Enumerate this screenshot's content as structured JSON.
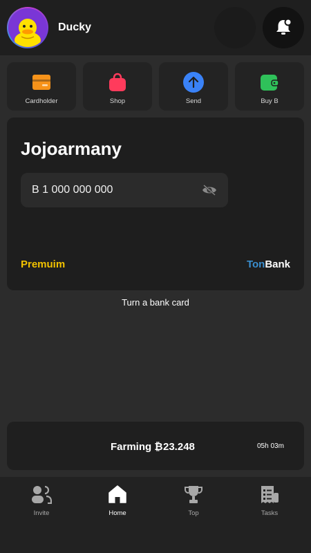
{
  "header": {
    "username": "Ducky",
    "avatar_icon": "duck-avatar-icon",
    "bell_icon": "bell-notification-icon"
  },
  "actions": [
    {
      "label": "Cardholder",
      "icon": "cardholder-icon",
      "color": "#f7931a"
    },
    {
      "label": "Shop",
      "icon": "shop-bag-icon",
      "color": "#ff3b5c"
    },
    {
      "label": "Send",
      "icon": "send-arrow-up-icon",
      "color": "#3a82f7"
    },
    {
      "label": "Buy B",
      "icon": "wallet-icon",
      "color": "#2fc15a"
    }
  ],
  "card": {
    "title": "Jojoarmany",
    "balance": "B 1 000 000 000",
    "eye_icon": "hide-balance-eye-icon",
    "tier": "Premuim",
    "brand_part1": "Ton",
    "brand_part2": "Bank",
    "tier_color": "#f2c200",
    "brand_color": "#3a8fd0"
  },
  "turn_card_label": "Turn a bank card",
  "farming": {
    "label": "Farming ₿",
    "value": "23.248",
    "time_left": "05h 03m"
  },
  "nav": [
    {
      "label": "Invite",
      "icon": "invite-users-icon",
      "active": false
    },
    {
      "label": "Home",
      "icon": "home-icon",
      "active": true
    },
    {
      "label": "Top",
      "icon": "trophy-icon",
      "active": false
    },
    {
      "label": "Tasks",
      "icon": "tasks-list-icon",
      "active": false
    }
  ]
}
